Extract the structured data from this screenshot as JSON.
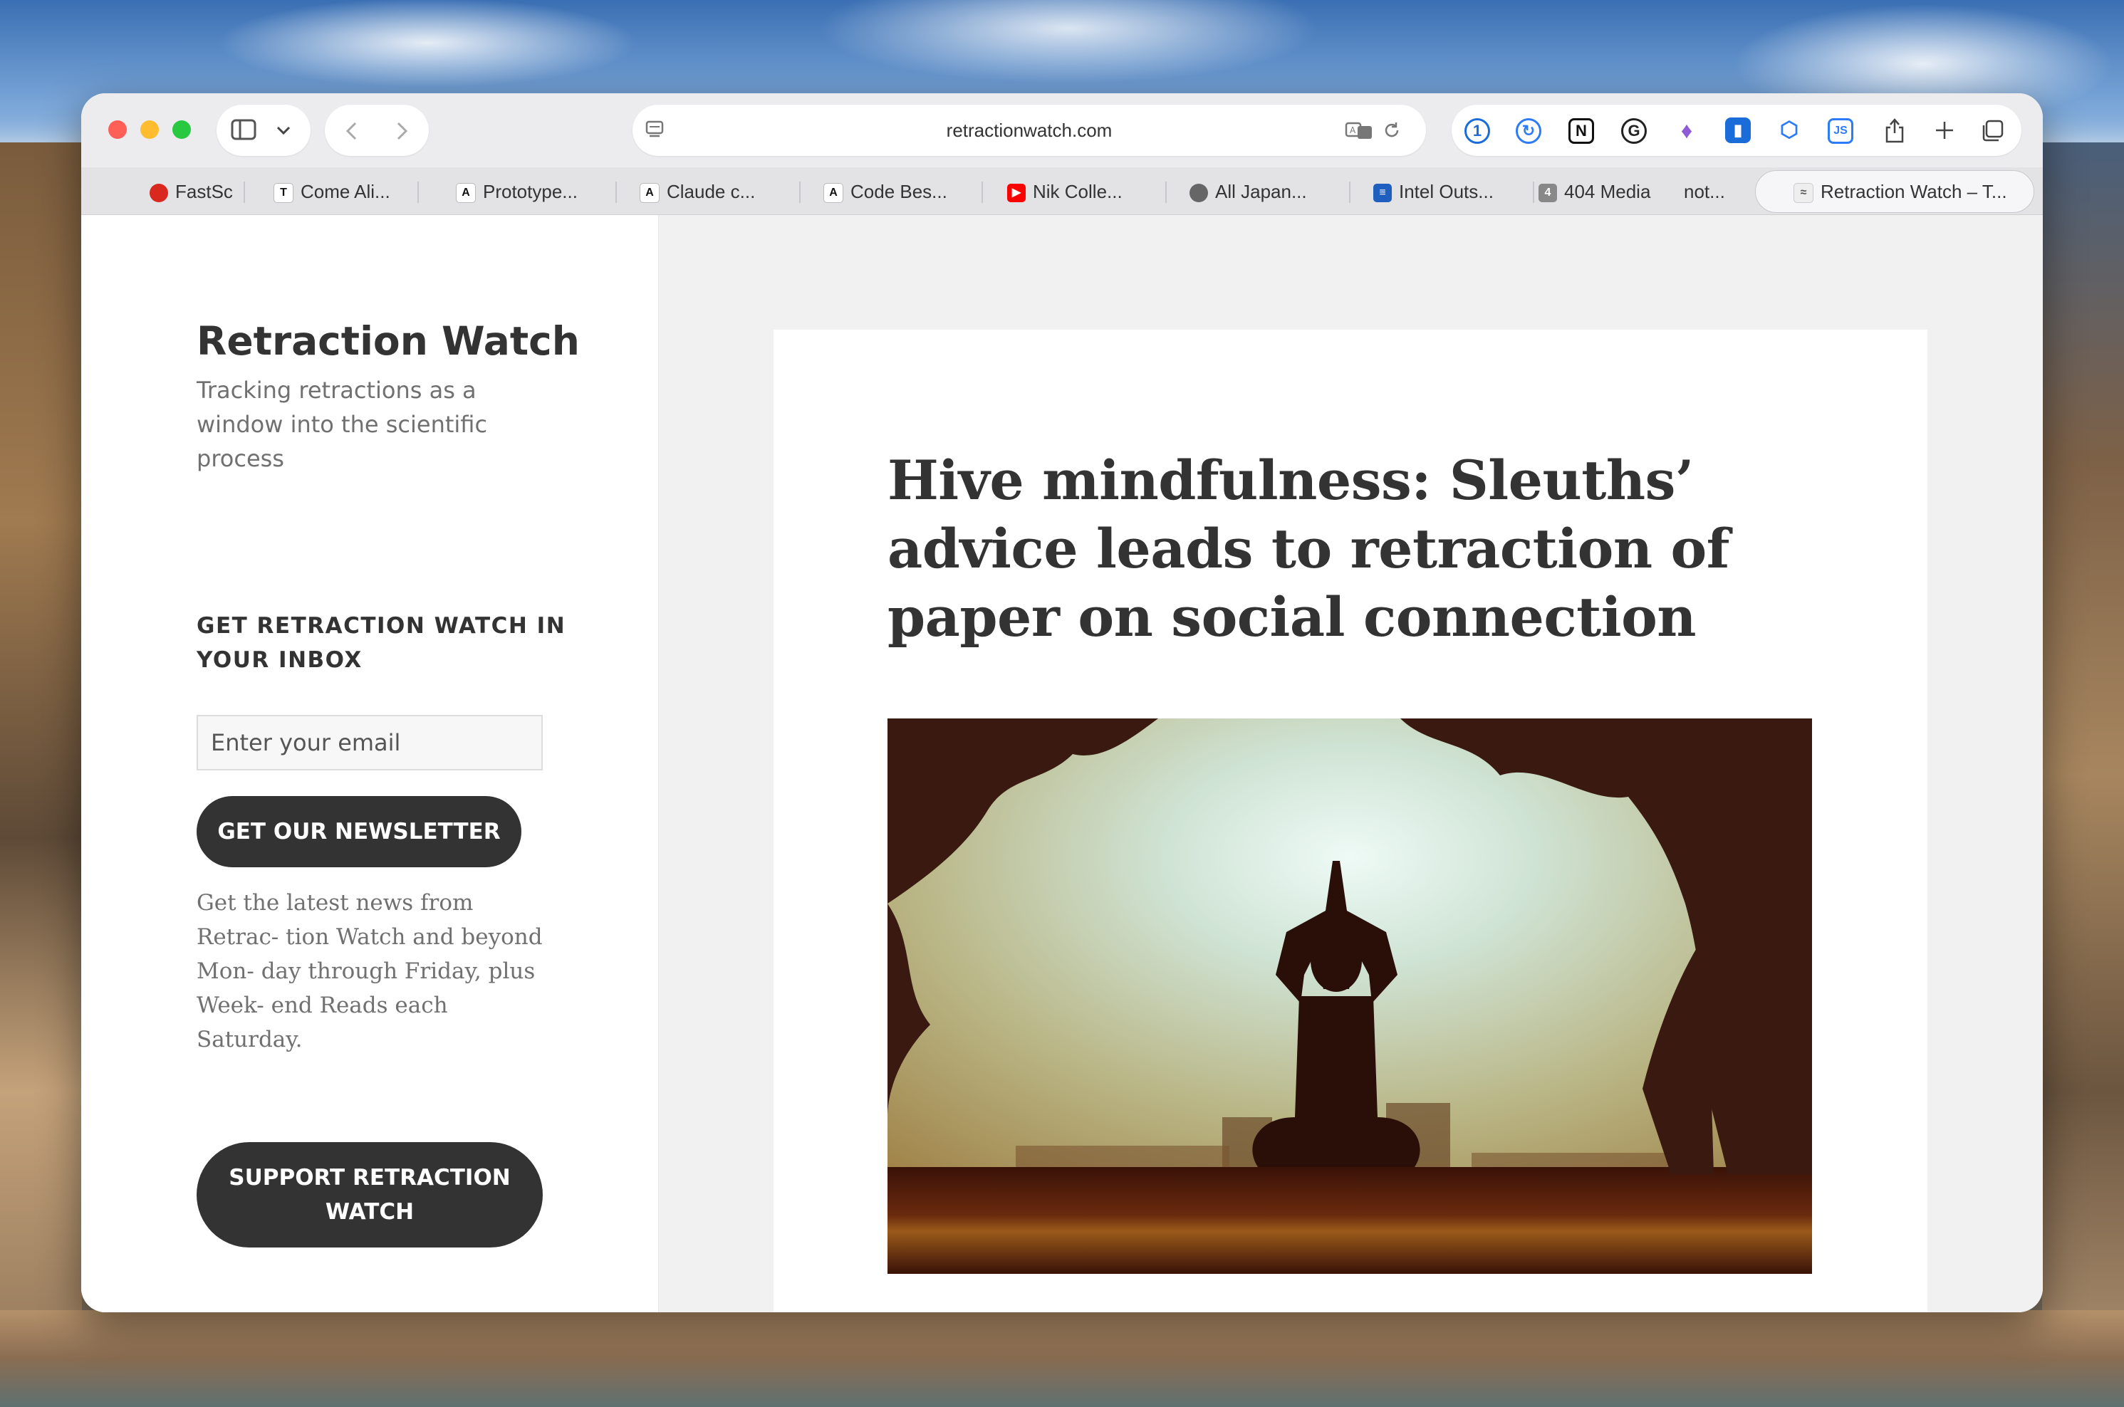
{
  "browser": {
    "url": "retractionwatch.com",
    "tabs": [
      {
        "label": "FastSc",
        "icon": "tab-favicon-fastsc",
        "color": "#d9281e"
      },
      {
        "label": "Come Ali...",
        "icon": "tab-favicon-tl",
        "color": "#222222"
      },
      {
        "label": "Prototype...",
        "icon": "tab-favicon-anthropic",
        "color": "#222222"
      },
      {
        "label": "Claude c...",
        "icon": "tab-favicon-anthropic",
        "color": "#222222"
      },
      {
        "label": "Code Bes...",
        "icon": "tab-favicon-anthropic",
        "color": "#222222"
      },
      {
        "label": "Nik Colle...",
        "icon": "tab-favicon-youtube",
        "color": "#ff0000"
      },
      {
        "label": "All Japan...",
        "icon": "tab-favicon-person",
        "color": "#444444"
      },
      {
        "label": "Intel Outs...",
        "icon": "tab-favicon-document",
        "color": "#1f5fbf"
      },
      {
        "label": "404 Media",
        "icon": "tab-favicon-404",
        "color": "#777777"
      },
      {
        "label": "not...",
        "icon": "",
        "color": ""
      },
      {
        "label": "Retraction Watch – T...",
        "icon": "tab-favicon-retraction",
        "color": "#888888"
      }
    ],
    "extensions": [
      "1password-icon",
      "refresh-circle-icon",
      "notion-icon",
      "grammarly-icon",
      "leaf-icon",
      "bookmark-icon",
      "cube-icon",
      "js-icon"
    ]
  },
  "site": {
    "title": "Retraction Watch",
    "description": "Tracking retractions as a window into the scientific process"
  },
  "newsletter": {
    "heading": "GET RETRACTION WATCH IN YOUR INBOX",
    "email_placeholder": "Enter your email",
    "button": "GET OUR NEWSLETTER",
    "description": "Get the latest news from Retrac- tion Watch and beyond Mon- day through Friday, plus Week- end Reads each Saturday."
  },
  "support": {
    "button": "SUPPORT RETRACTION WATCH"
  },
  "article": {
    "headline": "Hive mindfulness: Sleuths’ advice leads to retraction of paper on social connection"
  }
}
